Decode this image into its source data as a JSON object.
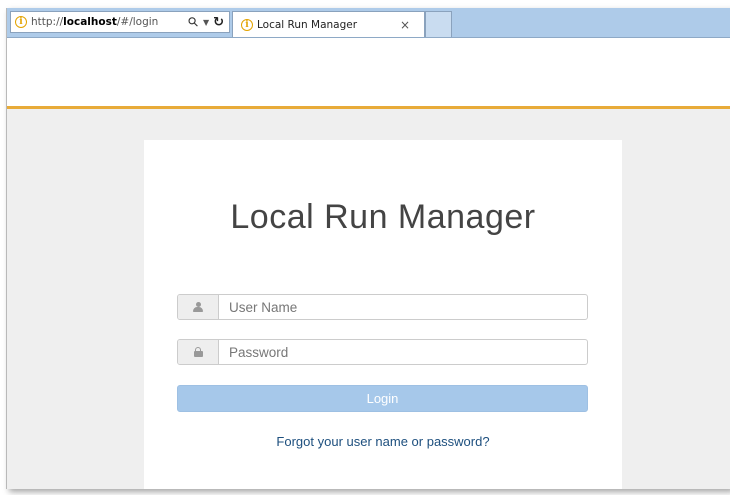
{
  "browser": {
    "address": {
      "url_prefix": "http://",
      "url_host": "localhost",
      "url_suffix": "/#/login"
    },
    "tab": {
      "title": "Local Run Manager",
      "close_glyph": "×"
    },
    "icons": {
      "info": "info-icon",
      "search": "search-icon",
      "dropdown": "chevron-down-icon",
      "refresh": "refresh-icon"
    }
  },
  "login": {
    "title": "Local Run Manager",
    "username_placeholder": "User Name",
    "password_placeholder": "Password",
    "username_value": "",
    "password_value": "",
    "login_label": "Login",
    "forgot_link": "Forgot your user name or password?"
  },
  "colors": {
    "header_accent": "#e8ab39",
    "button_bg": "#a6c8ea",
    "link": "#1d4f7e",
    "tabbar": "#aecbe9"
  }
}
